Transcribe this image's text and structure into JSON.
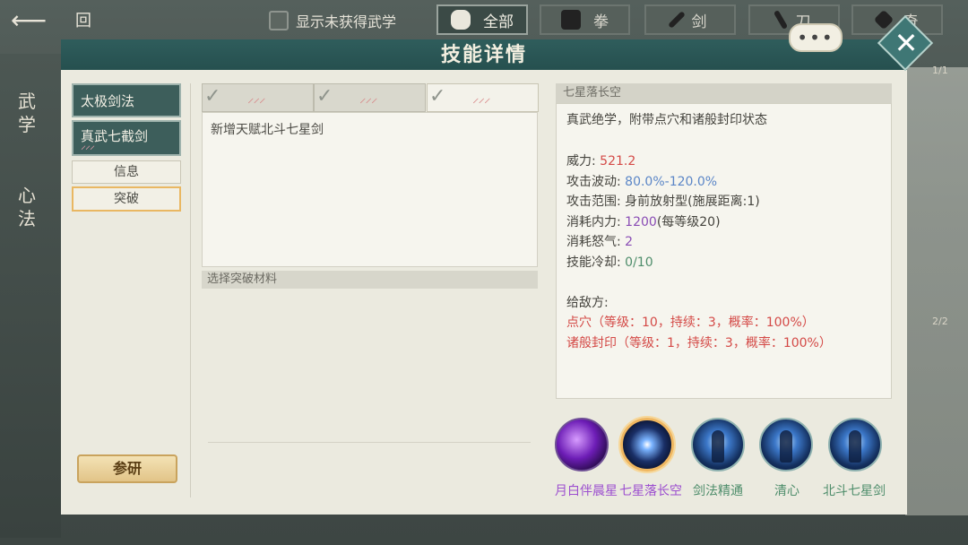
{
  "topbar": {
    "back_label": "回",
    "show_unobtained_label": "显示未获得武学",
    "tabs": [
      {
        "label": "全部",
        "icon": "pouch-icon",
        "active": true
      },
      {
        "label": "拳",
        "icon": "fist-icon",
        "active": false
      },
      {
        "label": "剑",
        "icon": "sword-icon",
        "active": false
      },
      {
        "label": "刀",
        "icon": "blade-icon",
        "active": false
      },
      {
        "label": "奇",
        "icon": "shuriken-icon",
        "active": false
      }
    ]
  },
  "side_nav": {
    "wuxue": "武学",
    "xinfa": "心法"
  },
  "dialog": {
    "title": "技能详情",
    "chat_bubble": "•••",
    "counts": [
      "1/1",
      "2/2"
    ]
  },
  "left_list": {
    "skill_1": "太极剑法",
    "skill_2": "真武七截剑",
    "skill_2_marks": "⸝⸝⸝",
    "info_button": "信息",
    "break_button": "突破",
    "study_button": "参研"
  },
  "middle": {
    "new_talent_text": "新增天赋北斗七星剑",
    "material_header": "选择突破材料"
  },
  "detail": {
    "header": "七星落长空",
    "description": "真武绝学，附带点穴和诸般封印状态",
    "power_label": "威力:",
    "power_value": "521.2",
    "fluct_label": "攻击波动:",
    "fluct_value": "80.0%-120.0%",
    "range_label": "攻击范围:",
    "range_value": "身前放射型(施展距离:1)",
    "neili_label": "消耗内力:",
    "neili_value": "1200",
    "neili_extra": "(每等级20)",
    "nuqi_label": "消耗怒气:",
    "nuqi_value": "2",
    "cd_label": "技能冷却:",
    "cd_value": "0/10",
    "enemy_label": "给敌方:",
    "effect_1": "点穴（等级：10，持续：3，概率：100%）",
    "effect_2": "诸般封印（等级：1，持续：3，概率：100%）"
  },
  "skill_icons": [
    {
      "label": "月白伴晨星",
      "selected": false
    },
    {
      "label": "七星落长空",
      "selected": true
    },
    {
      "label": "剑法精通",
      "selected": false
    },
    {
      "label": "清心",
      "selected": false
    },
    {
      "label": "北斗七星剑",
      "selected": false
    }
  ],
  "colors": {
    "header": "#2f5d5c",
    "panel": "#ebeadf",
    "accent_gold": "#e9b762",
    "red": "#d44a47",
    "blue": "#5b86c7",
    "purple": "#8a4db5",
    "green": "#4e8d6b"
  }
}
